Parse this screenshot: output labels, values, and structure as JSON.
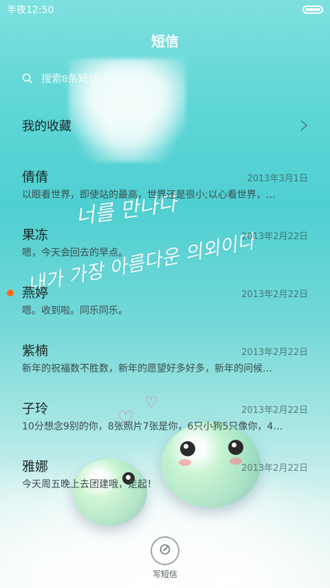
{
  "status_bar": {
    "time": "半夜12:50",
    "battery_icon": "battery-icon"
  },
  "header": {
    "title": "短信"
  },
  "search": {
    "placeholder": "搜索8条短信",
    "icon": "search-icon"
  },
  "favorites": {
    "label": "我的收藏",
    "icon": "chevron-right-icon"
  },
  "conversations": [
    {
      "name": "倩倩",
      "date": "2013年3月1日",
      "preview": "以眼看世界，即使站的最高，世界还是很小;以心看世界，…",
      "unread": false
    },
    {
      "name": "果冻",
      "date": "2013年2月22日",
      "preview": "嗯，今天会回去的早点。",
      "unread": false
    },
    {
      "name": "燕婷",
      "date": "2013年2月22日",
      "preview": "嗯。收到啦。同乐同乐。",
      "unread": true
    },
    {
      "name": "紫楠",
      "date": "2013年2月22日",
      "preview": "新年的祝福数不胜数，新年的愿望好多好多，新年的问候…",
      "unread": false
    },
    {
      "name": "子玲",
      "date": "2013年2月22日",
      "preview": "10分想念9别的你，8张照片7张是你，6只小狗5只像你，4…",
      "unread": false
    },
    {
      "name": "雅娜",
      "date": "2013年2月22日",
      "preview": "今天周五晚上去团建哦，走起！",
      "unread": false
    }
  ],
  "compose": {
    "label": "写短信",
    "icon": "compose-pen-icon"
  },
  "wallpaper": {
    "line1": "너를 만나다",
    "line2": "내가 가장 아름다운 의외이다"
  },
  "colors": {
    "unread_dot": "#ff6a1a",
    "text_primary": "#1b2626"
  }
}
